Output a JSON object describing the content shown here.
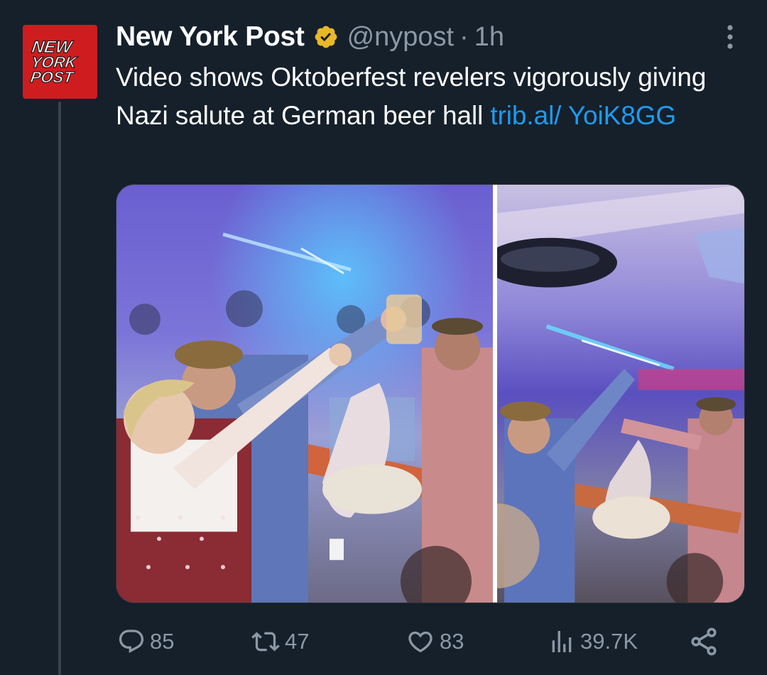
{
  "tweet": {
    "author": {
      "display_name": "New York Post",
      "handle": "@nypost",
      "separator": "·",
      "time": "1h",
      "avatar_logo": "New York Post logo",
      "verified_icon": "verified-badge-icon",
      "verified_color": "#e8b829"
    },
    "text_main": "Video shows Oktoberfest revelers vigorously giving Nazi salute at German beer hall ",
    "link_text": "trib.al/ YoiK8GG",
    "link_color": "#1d9bf0",
    "media": {
      "layout": "two-image side-by-side video thumbnail"
    },
    "actions": {
      "reply": {
        "icon": "reply-icon",
        "count": "85"
      },
      "retweet": {
        "icon": "retweet-icon",
        "count": "47"
      },
      "like": {
        "icon": "heart-icon",
        "count": "83"
      },
      "views": {
        "icon": "views-icon",
        "count": "39.7K"
      },
      "share": {
        "icon": "share-icon"
      }
    },
    "more_icon": "more-options-icon"
  },
  "theme": {
    "background": "#15202b",
    "text_primary": "#ffffff",
    "text_secondary": "#8b98a5"
  }
}
